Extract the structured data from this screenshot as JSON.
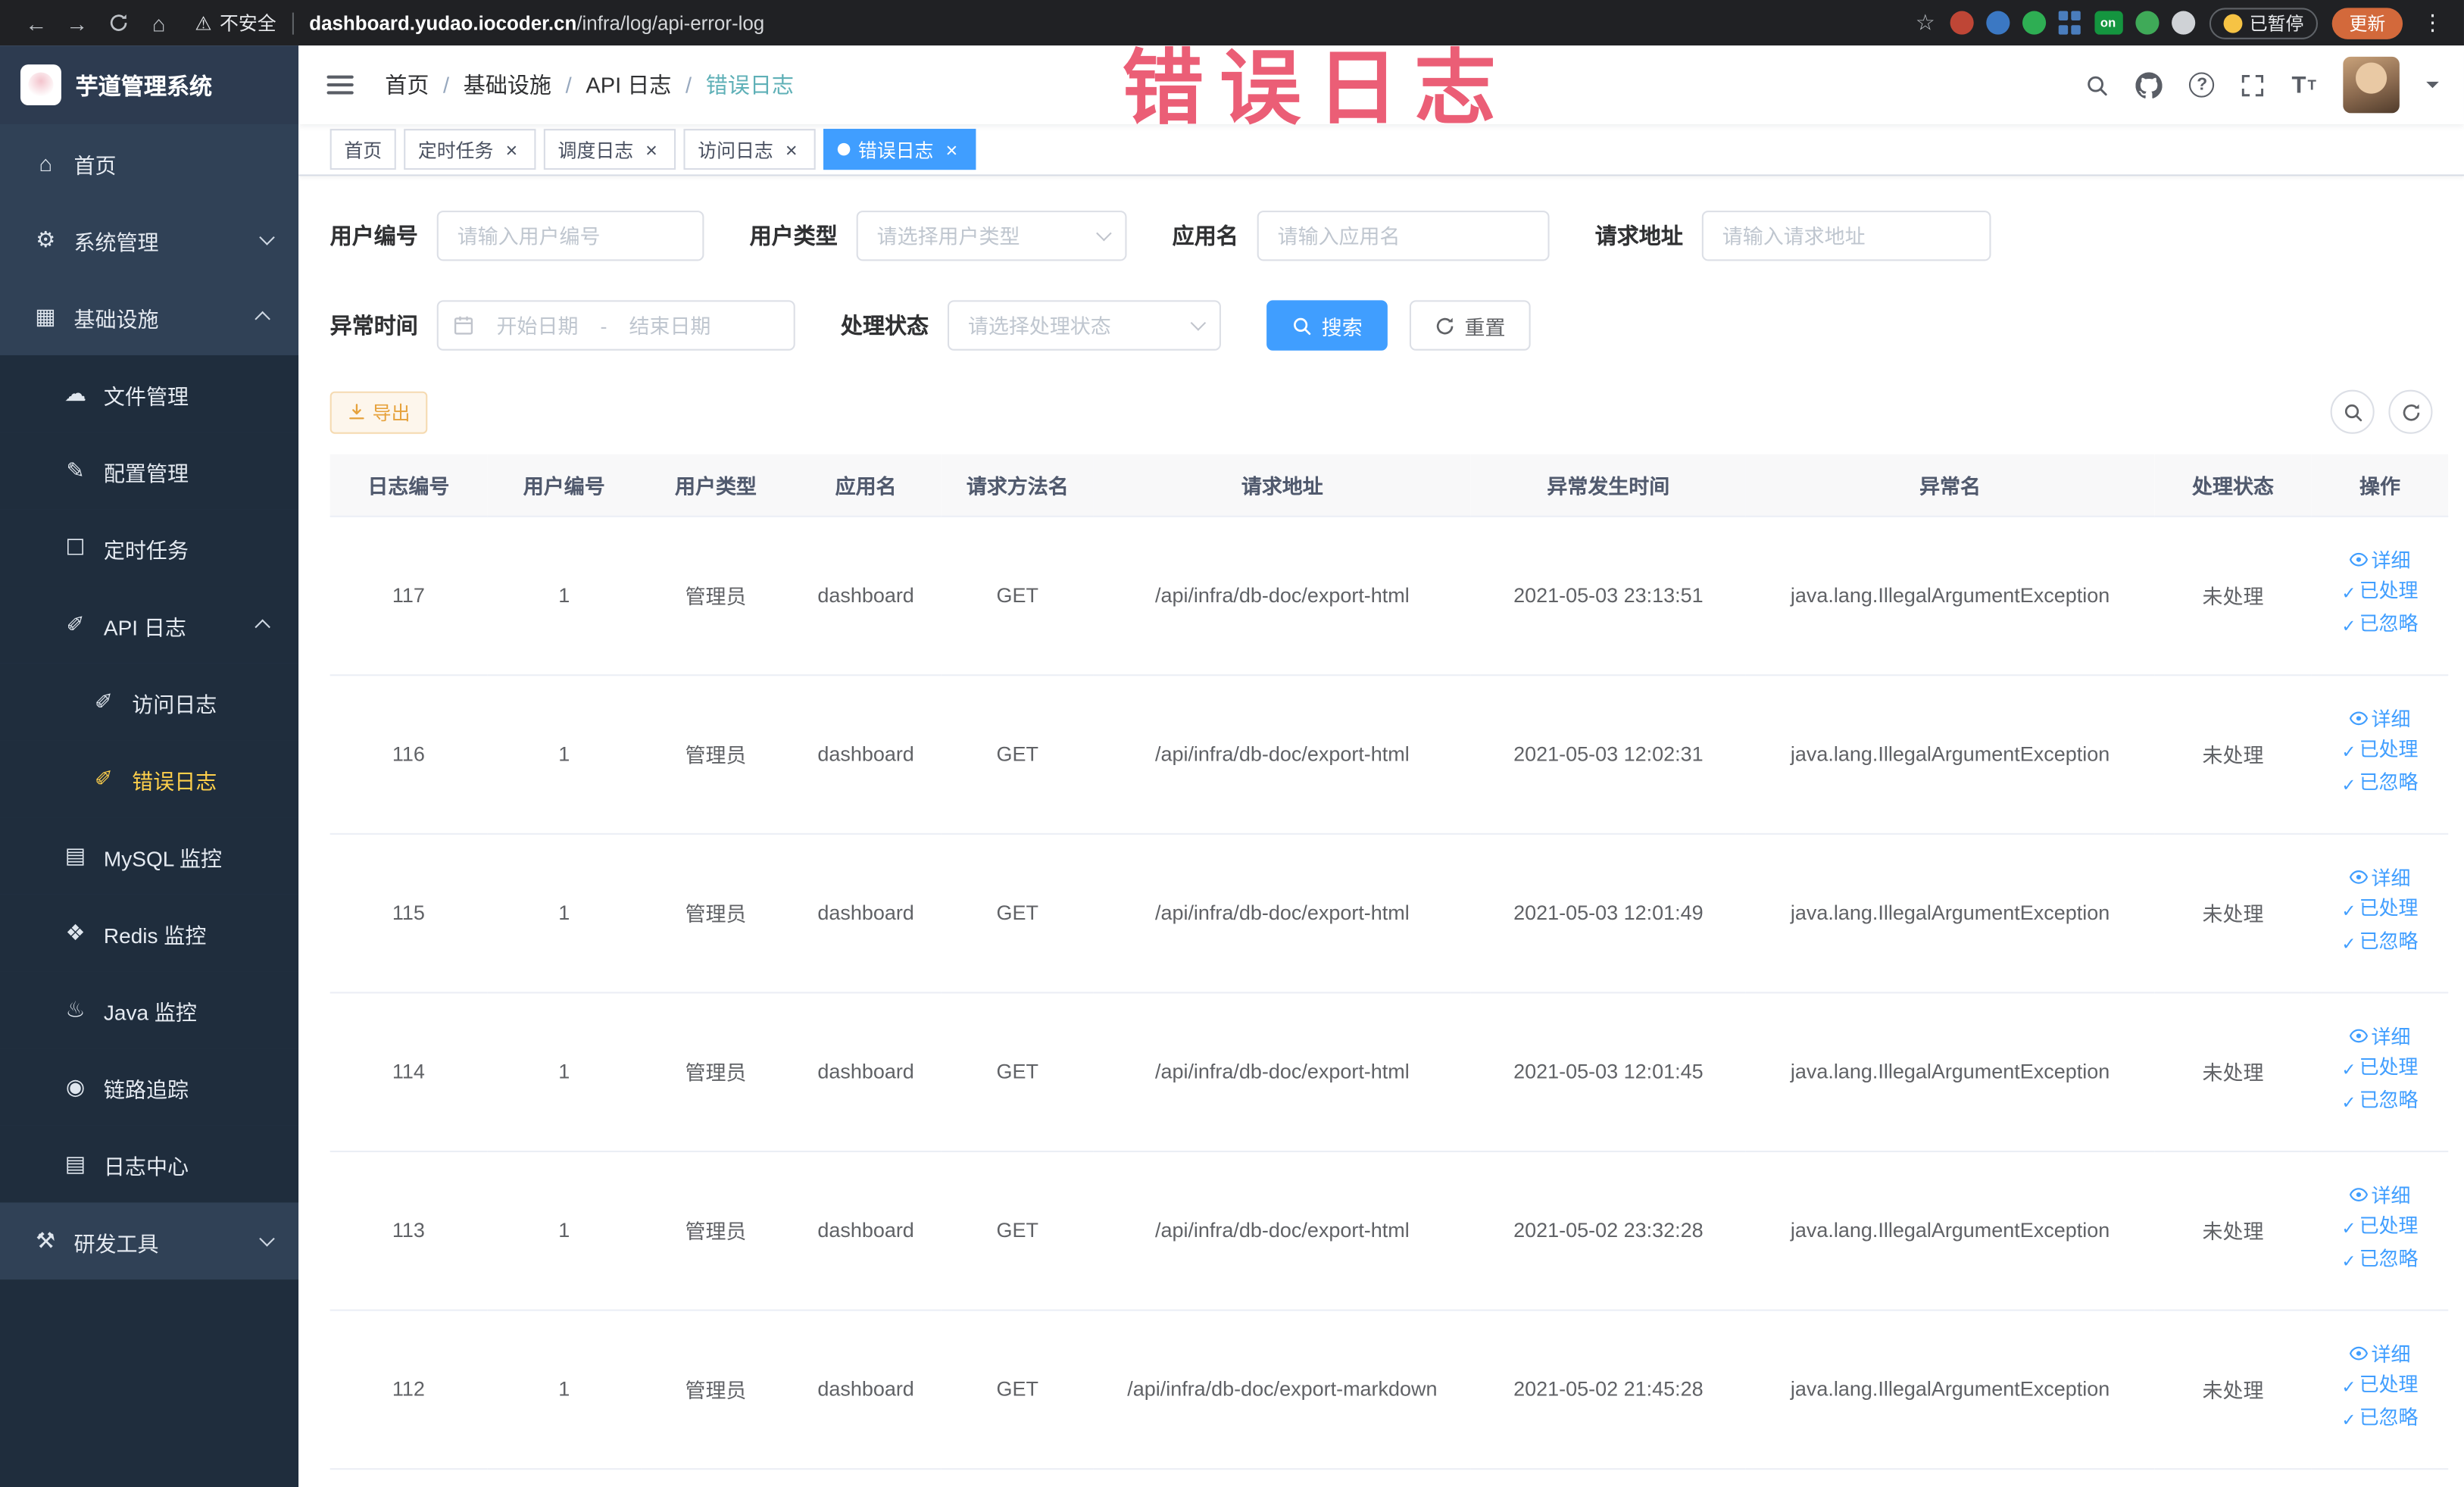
{
  "colors": {
    "primary": "#409eff",
    "sidebar_active": "#ffd04b",
    "warning": "#e6a23c",
    "annotation": "#e8435f"
  },
  "browser": {
    "security_label": "不安全",
    "url_domain": "dashboard.yudao.iocoder.cn",
    "url_path": "/infra/log/api-error-log",
    "extensions": [
      {
        "name": "extension-red-circle-icon",
        "color": "#bf4636",
        "shape": "circle"
      },
      {
        "name": "extension-blue-drop-icon",
        "color": "#3b78c3",
        "shape": "circle"
      },
      {
        "name": "extension-green-circle-icon",
        "color": "#2eae53",
        "shape": "circle"
      },
      {
        "name": "extension-blue-grid-icon",
        "color": "#4a7dbd",
        "shape": "grid"
      },
      {
        "name": "extension-on-badge-icon",
        "color": "#14953f",
        "shape": "badge",
        "label": "on"
      },
      {
        "name": "extension-leaf-icon",
        "color": "#3faa58",
        "shape": "circle"
      },
      {
        "name": "extension-paw-icon",
        "color": "#cfd2d6",
        "shape": "circle"
      }
    ],
    "paused_badge": "已暂停",
    "update_button": "更新"
  },
  "sidebar": {
    "logo_title": "芋道管理系统",
    "items": [
      {
        "key": "home",
        "label": "首页",
        "level": 0,
        "icon": "home"
      },
      {
        "key": "system",
        "label": "系统管理",
        "level": 0,
        "icon": "gear",
        "chevron": "down"
      },
      {
        "key": "infra",
        "label": "基础设施",
        "level": 0,
        "icon": "grid",
        "chevron": "up"
      },
      {
        "key": "file",
        "label": "文件管理",
        "level": 1,
        "icon": "cloud",
        "sub": true
      },
      {
        "key": "config",
        "label": "配置管理",
        "level": 1,
        "icon": "edit",
        "sub": true
      },
      {
        "key": "job",
        "label": "定时任务",
        "level": 1,
        "icon": "checkbox",
        "sub": true
      },
      {
        "key": "api-log",
        "label": "API 日志",
        "level": 1,
        "icon": "pen",
        "chevron": "up",
        "sub": true
      },
      {
        "key": "access-log",
        "label": "访问日志",
        "level": 2,
        "icon": "pen",
        "sub": true
      },
      {
        "key": "error-log",
        "label": "错误日志",
        "level": 2,
        "icon": "pen",
        "sub": true,
        "active": true
      },
      {
        "key": "mysql",
        "label": "MySQL 监控",
        "level": 1,
        "icon": "database",
        "sub": true
      },
      {
        "key": "redis",
        "label": "Redis 监控",
        "level": 1,
        "icon": "diamond",
        "sub": true
      },
      {
        "key": "java",
        "label": "Java 监控",
        "level": 1,
        "icon": "coffee",
        "sub": true
      },
      {
        "key": "trace",
        "label": "链路追踪",
        "level": 1,
        "icon": "eye",
        "sub": true
      },
      {
        "key": "log-center",
        "label": "日志中心",
        "level": 1,
        "icon": "document",
        "sub": true
      },
      {
        "key": "dev-tools",
        "label": "研发工具",
        "level": 0,
        "icon": "tools",
        "chevron": "down"
      }
    ]
  },
  "header": {
    "breadcrumb": [
      "首页",
      "基础设施",
      "API 日志",
      "错误日志"
    ],
    "separator": "/",
    "annotation": "错误日志"
  },
  "tabs": [
    {
      "key": "home",
      "label": "首页",
      "closable": false,
      "active": false
    },
    {
      "key": "job",
      "label": "定时任务",
      "closable": true,
      "active": false
    },
    {
      "key": "job-log",
      "label": "调度日志",
      "closable": true,
      "active": false
    },
    {
      "key": "access-log",
      "label": "访问日志",
      "closable": true,
      "active": false
    },
    {
      "key": "error-log",
      "label": "错误日志",
      "closable": true,
      "active": true
    }
  ],
  "filters": {
    "user_id": {
      "label": "用户编号",
      "placeholder": "请输入用户编号"
    },
    "user_type": {
      "label": "用户类型",
      "placeholder": "请选择用户类型"
    },
    "app_name": {
      "label": "应用名",
      "placeholder": "请输入应用名"
    },
    "request_url": {
      "label": "请求地址",
      "placeholder": "请输入请求地址"
    },
    "exception_time": {
      "label": "异常时间",
      "start_placeholder": "开始日期",
      "separator": "-",
      "end_placeholder": "结束日期"
    },
    "process_status": {
      "label": "处理状态",
      "placeholder": "请选择处理状态"
    },
    "search_button": "搜索",
    "reset_button": "重置"
  },
  "toolbar": {
    "export_button": "导出"
  },
  "table": {
    "columns": [
      "日志编号",
      "用户编号",
      "用户类型",
      "应用名",
      "请求方法名",
      "请求地址",
      "异常发生时间",
      "异常名",
      "处理状态",
      "操作"
    ],
    "rows": [
      {
        "id": "117",
        "user_id": "1",
        "user_type": "管理员",
        "app": "dashboard",
        "method": "GET",
        "url": "/api/infra/db-doc/export-html",
        "time": "2021-05-03 23:13:51",
        "exception": "java.lang.IllegalArgumentException",
        "status": "未处理"
      },
      {
        "id": "116",
        "user_id": "1",
        "user_type": "管理员",
        "app": "dashboard",
        "method": "GET",
        "url": "/api/infra/db-doc/export-html",
        "time": "2021-05-03 12:02:31",
        "exception": "java.lang.IllegalArgumentException",
        "status": "未处理"
      },
      {
        "id": "115",
        "user_id": "1",
        "user_type": "管理员",
        "app": "dashboard",
        "method": "GET",
        "url": "/api/infra/db-doc/export-html",
        "time": "2021-05-03 12:01:49",
        "exception": "java.lang.IllegalArgumentException",
        "status": "未处理"
      },
      {
        "id": "114",
        "user_id": "1",
        "user_type": "管理员",
        "app": "dashboard",
        "method": "GET",
        "url": "/api/infra/db-doc/export-html",
        "time": "2021-05-03 12:01:45",
        "exception": "java.lang.IllegalArgumentException",
        "status": "未处理"
      },
      {
        "id": "113",
        "user_id": "1",
        "user_type": "管理员",
        "app": "dashboard",
        "method": "GET",
        "url": "/api/infra/db-doc/export-html",
        "time": "2021-05-02 23:32:28",
        "exception": "java.lang.IllegalArgumentException",
        "status": "未处理"
      },
      {
        "id": "112",
        "user_id": "1",
        "user_type": "管理员",
        "app": "dashboard",
        "method": "GET",
        "url": "/api/infra/db-doc/export-markdown",
        "time": "2021-05-02 21:45:28",
        "exception": "java.lang.IllegalArgumentException",
        "status": "未处理"
      }
    ],
    "actions": [
      {
        "key": "detail",
        "label": "详细",
        "icon": "eye"
      },
      {
        "key": "processed",
        "label": "已处理",
        "icon": "check"
      },
      {
        "key": "ignored",
        "label": "已忽略",
        "icon": "check"
      }
    ]
  }
}
